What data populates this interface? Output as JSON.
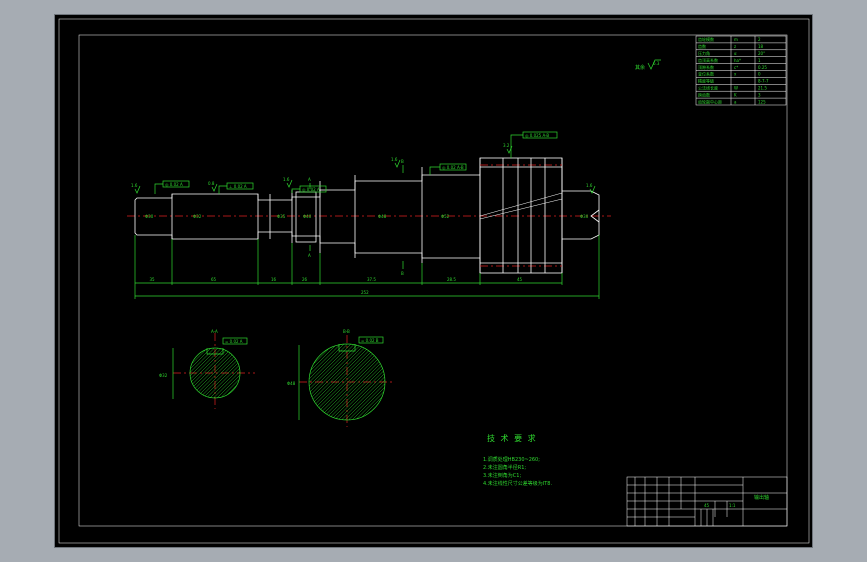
{
  "parameter_table": {
    "rows": [
      {
        "name": "齿轮模数",
        "symbol": "m",
        "value": "2"
      },
      {
        "name": "齿数",
        "symbol": "z",
        "value": "18"
      },
      {
        "name": "压力角",
        "symbol": "α",
        "value": "20°"
      },
      {
        "name": "齿顶高系数",
        "symbol": "ha*",
        "value": "1"
      },
      {
        "name": "顶隙系数",
        "symbol": "c*",
        "value": "0.25"
      },
      {
        "name": "变位系数",
        "symbol": "x",
        "value": "0"
      },
      {
        "name": "精度等级",
        "symbol": "",
        "value": "8-7-7"
      },
      {
        "name": "公法线长度",
        "symbol": "W",
        "value": "21.5"
      },
      {
        "name": "跨齿数",
        "symbol": "K",
        "value": "3"
      },
      {
        "name": "齿轮副中心距",
        "symbol": "a",
        "value": "125"
      }
    ]
  },
  "roughness_note": "其余",
  "roughness_note_value": "6.3",
  "technical_requirements": {
    "title": "技 术 要 求",
    "items": [
      "1.调质处理HB230~260;",
      "2.未注圆角半径R1;",
      "3.未注倒角为C1;",
      "4.未注线性尺寸公差等级为IT8."
    ]
  },
  "dimensions": {
    "segments": [
      "35",
      "65",
      "16",
      "26",
      "37.5",
      "28.5",
      "45"
    ],
    "overall": "252"
  },
  "title_block": {
    "part_name": "输出轴",
    "material": "45",
    "scale": "1:1"
  }
}
